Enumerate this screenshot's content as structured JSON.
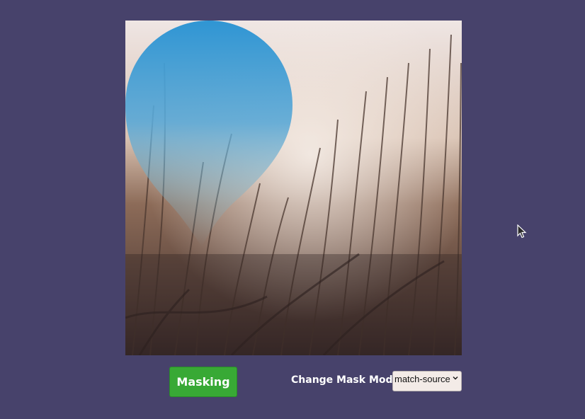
{
  "image": {
    "description_icon": "masked-photo",
    "mask_color": "#2f95d3"
  },
  "controls": {
    "masking_label": "Masking",
    "mode_label": "Change Mask Mode:",
    "mode_selected": "match-source"
  },
  "colors": {
    "background": "#47426b",
    "button": "#38a935"
  }
}
